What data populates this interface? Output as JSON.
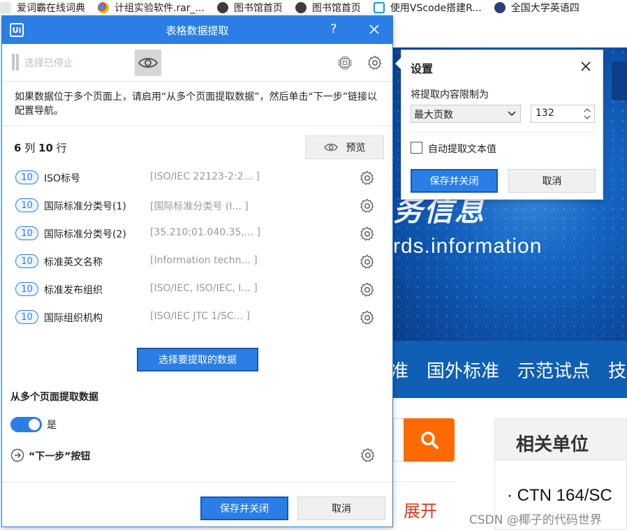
{
  "bookmarks": [
    {
      "label": "爱词霸在线词典",
      "icon": "iciba-icon",
      "color": "#e8e8e8"
    },
    {
      "label": "计组实验软件.rar_...",
      "icon": "baidu-pan-icon",
      "color": "#3a8ee6"
    },
    {
      "label": "图书馆首页",
      "icon": "globe-icon",
      "color": "#444444"
    },
    {
      "label": "图书馆首页",
      "icon": "globe-icon",
      "color": "#444444"
    },
    {
      "label": "使用VScode搭建R...",
      "icon": "bilibili-icon",
      "color": "#00a1d6"
    },
    {
      "label": "全国大学英语四",
      "icon": "seal-icon",
      "color": "#2c3e7a"
    }
  ],
  "dialog": {
    "title": "表格数据提取",
    "help_label": "?",
    "stopped_label": "选择已停止",
    "info_text": "如果数据位于多个页面上，请启用“从多个页面提取数据”，然后单击“下一步”链接以配置导航。",
    "count": {
      "cols": "6",
      "cols_unit": "列",
      "rows": "10",
      "rows_unit": "行"
    },
    "preview_label": "预览",
    "fields": [
      {
        "count": "10",
        "name": "ISO标号",
        "value": "[ISO/IEC 22123-2:2... ]"
      },
      {
        "count": "10",
        "name": "国际标准分类号(1)",
        "value": "[国际标准分类号   (I...   ]"
      },
      {
        "count": "10",
        "name": "国际标准分类号(2)",
        "value": "[35.210;01.040.35,... ]"
      },
      {
        "count": "10",
        "name": "标准英文名称",
        "value": "[Information techn... ]"
      },
      {
        "count": "10",
        "name": "标准发布组织",
        "value": "[ISO/IEC, ISO/IEC, I... ]"
      },
      {
        "count": "10",
        "name": "国际组织机构",
        "value": "[ISO/IEC JTC 1/SC...   ]"
      }
    ],
    "select_button": "选择要提取的数据",
    "multi_page_title": "从多个页面提取数据",
    "multi_page_toggle": "是",
    "multi_page_enabled": true,
    "next_button_label": "“下一步”按钮",
    "save_button": "保存并关闭",
    "cancel_button": "取消"
  },
  "settings": {
    "title": "设置",
    "limit_label": "将提取内容限制为",
    "limit_option": "最大页数",
    "limit_value": "132",
    "auto_extract_label": "自动提取文本值",
    "auto_extract_checked": false,
    "save_button": "保存并关闭",
    "cancel_button": "取消"
  },
  "webpage": {
    "tagline": "务信息",
    "english": "rds.information",
    "nav": [
      "准",
      "国外标准",
      "示范试点",
      "技"
    ],
    "related_title": "相关单位",
    "related_item": "· CTN 164/SC",
    "expand_label": "展开"
  },
  "watermark": "CSDN @椰子的代码世界",
  "colors": {
    "accent": "#2a7ee6",
    "orange": "#ff6a00",
    "nav_blue": "#0f5fb4"
  }
}
